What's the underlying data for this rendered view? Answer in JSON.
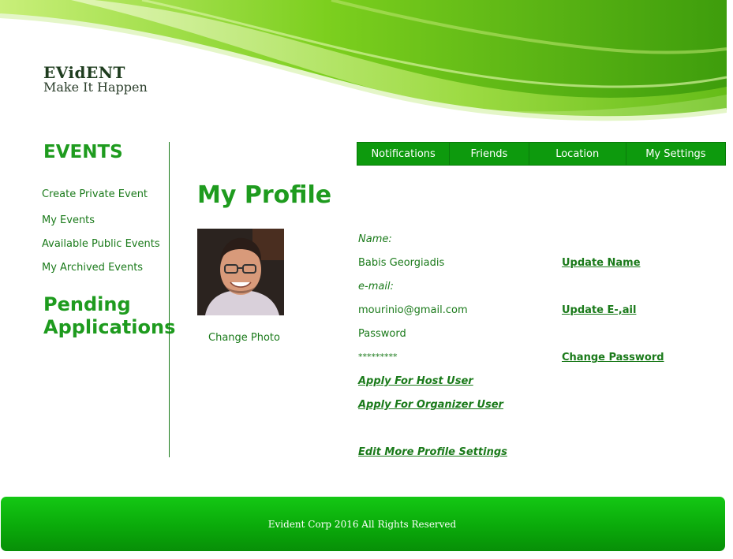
{
  "brand": {
    "title": "EVidENT",
    "tagline": "Make It Happen"
  },
  "nav": {
    "items": [
      {
        "label": "Notifications"
      },
      {
        "label": "Friends"
      },
      {
        "label": "Location"
      },
      {
        "label": "My Settings"
      }
    ]
  },
  "sidebar": {
    "title": "EVENTS",
    "links": [
      {
        "label": "Create Private Event"
      },
      {
        "label": "My Events"
      },
      {
        "label": "Available Public Events"
      },
      {
        "label": "My Archived Events"
      }
    ],
    "pending_line1": "Pending",
    "pending_line2": "Applications"
  },
  "profile": {
    "title": "My Profile",
    "change_photo": "Change Photo",
    "name_label": "Name:",
    "name_value": "Babis Georgiadis",
    "update_name": "Update Name",
    "email_label": "e-mail:",
    "email_value": "mourinio@gmail.com",
    "update_email": "Update E-,ail",
    "password_label": "Password",
    "password_value": "*********",
    "change_password": "Change Password",
    "apply_host": "Apply For Host User",
    "apply_organizer": "Apply For Organizer User",
    "edit_more": "Edit More Profile Settings"
  },
  "footer": {
    "text": "Evident Corp  2016 All Rights Reserved"
  },
  "colors": {
    "accent": "#1e9b1e",
    "nav_bg": "#0d9a0d",
    "footer_bg": "#0aaa0a"
  }
}
